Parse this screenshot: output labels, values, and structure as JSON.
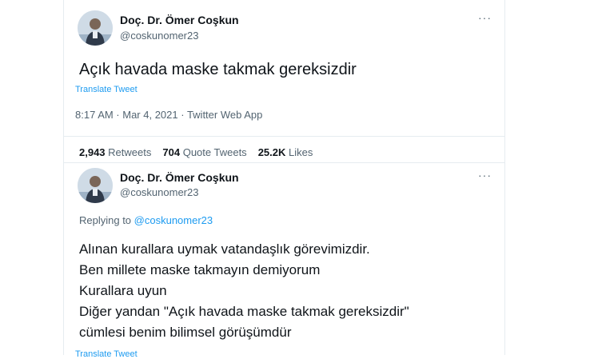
{
  "tweet": {
    "author_name": "Doç. Dr. Ömer Coşkun",
    "author_handle": "@coskunomer23",
    "more_label": "···",
    "text": "Açık havada maske takmak gereksizdir",
    "translate_label": "Translate Tweet",
    "timestamp": "8:17 AM · Mar 4, 2021 · Twitter Web App",
    "retweets_count": "2,943",
    "retweets_label": "Retweets",
    "quotes_count": "704",
    "quotes_label": "Quote Tweets",
    "likes_count": "25.2K",
    "likes_label": "Likes"
  },
  "reply": {
    "author_name": "Doç. Dr. Ömer Coşkun",
    "author_handle": "@coskunomer23",
    "more_label": "···",
    "replying_prefix": "Replying to ",
    "replying_handle": "@coskunomer23",
    "lines": [
      "Alınan kurallara uymak vatandaşlık görevimizdir.",
      "Ben millete maske takmayın demiyorum",
      "Kurallara uyun",
      "Diğer yandan \"Açık havada maske takmak gereksizdir\"",
      "cümlesi benim bilimsel görüşümdür"
    ],
    "translate_label": "Translate Tweet"
  },
  "icons": {
    "avatar": "avatar-portrait",
    "more": "more-horizontal-icon"
  },
  "colors": {
    "link": "#1d9bf0",
    "secondary_text": "#536471",
    "primary_text": "#0f1419",
    "border": "#e6ecf0"
  }
}
